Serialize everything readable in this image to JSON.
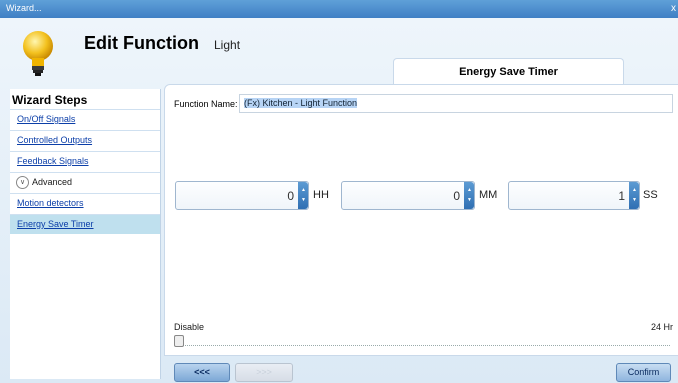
{
  "window": {
    "title": "Wizard...",
    "close": "x"
  },
  "header": {
    "title": "Edit Function",
    "subtitle": "Light"
  },
  "tab": {
    "label": "Energy Save Timer"
  },
  "sidebar": {
    "heading": "Wizard Steps",
    "items": [
      {
        "label": "On/Off Signals"
      },
      {
        "label": "Controlled Outputs"
      },
      {
        "label": "Feedback Signals"
      },
      {
        "label": "Advanced"
      },
      {
        "label": "Motion detectors"
      },
      {
        "label": "Energy Save Timer"
      }
    ]
  },
  "form": {
    "function_name_label": "Function Name:",
    "function_name_value": "(Fx) Kitchen - Light Function"
  },
  "timer": {
    "hours": {
      "value": "0",
      "unit": "HH"
    },
    "minutes": {
      "value": "0",
      "unit": "MM"
    },
    "seconds": {
      "value": "1",
      "unit": "SS"
    }
  },
  "slider": {
    "min_label": "Disable",
    "max_label": "24 Hr",
    "level": 0
  },
  "buttons": {
    "back": "<<<",
    "next": ">>>",
    "confirm": "Confirm"
  },
  "colors": {
    "accent": "#3f7fc4",
    "selected_row": "#bfe0ee",
    "link": "#0b3ea8"
  }
}
